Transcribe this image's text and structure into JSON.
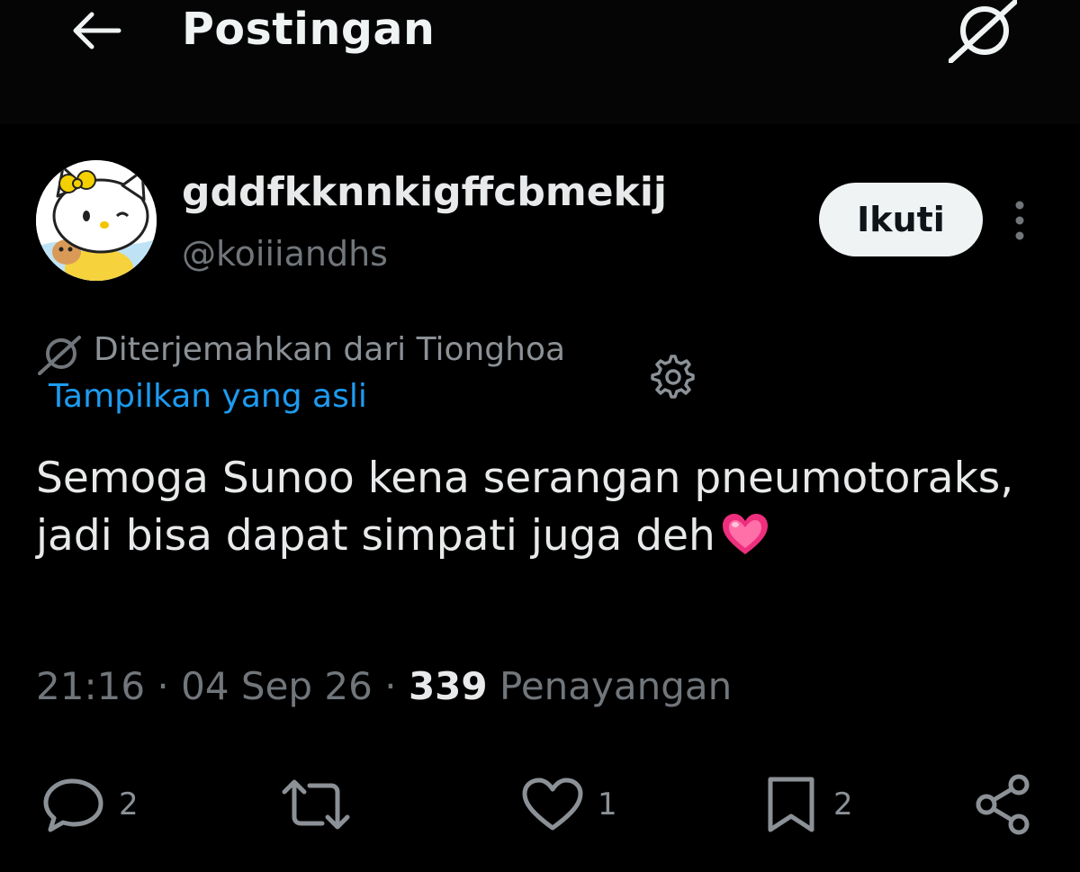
{
  "header": {
    "title": "Postingan"
  },
  "author": {
    "display_name": "gddfkknnkigffcbmekij",
    "handle": "@koiiiandhs",
    "follow_label": "Ikuti"
  },
  "translation": {
    "label": "Diterjemahkan dari Tionghoa",
    "show_original": "Tampilkan yang asli"
  },
  "post": {
    "text": "Semoga Sunoo kena serangan pneumotoraks, jadi bisa dapat simpati juga deh",
    "emoji": "pink-heart-emoji"
  },
  "meta": {
    "time": "21:16",
    "separator": "·",
    "date": "04 Sep 26",
    "views_count": "339",
    "views_label": "Penayangan"
  },
  "actions": {
    "reply_count": "2",
    "repost_count": "",
    "like_count": "1",
    "bookmark_count": "2"
  },
  "colors": {
    "background": "#000000",
    "accent": "#1d9bf0",
    "text_primary": "#e7e9ea",
    "text_secondary": "#71767b",
    "heart": "#ee2f7d"
  },
  "icons": {
    "back": "arrow-left-icon",
    "grok": "grok-icon",
    "more": "more-vertical-icon",
    "translate": "grok-icon",
    "settings": "gear-icon",
    "reply": "reply-icon",
    "repost": "repost-icon",
    "like": "heart-icon",
    "bookmark": "bookmark-icon",
    "share": "share-icon"
  }
}
